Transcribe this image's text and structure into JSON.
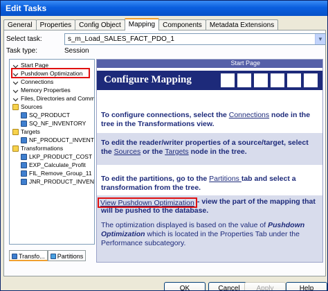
{
  "window": {
    "title": "Edit Tasks"
  },
  "tabs": [
    {
      "label": "General"
    },
    {
      "label": "Properties"
    },
    {
      "label": "Config Object"
    },
    {
      "label": "Mapping",
      "active": true
    },
    {
      "label": "Components"
    },
    {
      "label": "Metadata Extensions"
    }
  ],
  "form": {
    "select_task_label": "Select task:",
    "select_task_value": "s_m_Load_SALES_FACT_PDO_1",
    "task_type_label": "Task type:",
    "task_type_value": "Session"
  },
  "tree": {
    "items": [
      {
        "label": "Start Page",
        "icon": "node-icon",
        "indent": 0
      },
      {
        "label": "Pushdown Optimization",
        "icon": "node-icon",
        "indent": 0,
        "highlighted": true
      },
      {
        "label": "Connections",
        "icon": "node-icon",
        "indent": 0
      },
      {
        "label": "Memory Properties",
        "icon": "node-icon",
        "indent": 0
      },
      {
        "label": "Files, Directories and Commar",
        "icon": "node-icon",
        "indent": 0
      },
      {
        "label": "Sources",
        "icon": "folder-icon",
        "indent": 0
      },
      {
        "label": "SQ_PRODUCT",
        "icon": "object-icon",
        "indent": 1
      },
      {
        "label": "SQ_NF_INVENTORY",
        "icon": "object-icon",
        "indent": 1
      },
      {
        "label": "Targets",
        "icon": "folder-icon",
        "indent": 0
      },
      {
        "label": "NF_PRODUCT_INVENTOR",
        "icon": "object-icon",
        "indent": 1
      },
      {
        "label": "Transformations",
        "icon": "folder-icon",
        "indent": 0
      },
      {
        "label": "LKP_PRODUCT_COST",
        "icon": "object-icon",
        "indent": 1
      },
      {
        "label": "EXP_Calculate_Profit",
        "icon": "object-icon",
        "indent": 1
      },
      {
        "label": "FIL_Remove_Group_11",
        "icon": "object-icon",
        "indent": 1
      },
      {
        "label": "JNR_PRODUCT_INVENTO",
        "icon": "object-icon",
        "indent": 1
      }
    ]
  },
  "bottom_tabs": [
    {
      "label": "Transfo...",
      "active": true
    },
    {
      "label": "Partitions"
    }
  ],
  "content": {
    "header": "Start Page",
    "banner_title": "Configure Mapping",
    "p1_pre": "To configure connections, select the ",
    "p1_link": "Connections",
    "p1_post": " node in the tree in the Transformations view.",
    "p2_pre": "To edit the reader/writer properties of a source/target, select the ",
    "p2_link1": "Sources",
    "p2_mid": " or the ",
    "p2_link2": "Targets",
    "p2_post": " node in the tree.",
    "p3_pre": "To edit the partitions, go to the ",
    "p3_link": "Partitions ",
    "p3_post": "tab and select a transformation from the tree.",
    "p4_link": "View Pushdown Optimization",
    "p4_post": " - view the part of the mapping that will be pushed to the database.",
    "p5_pre": "The optimization displayed is based on the value of ",
    "p5_it": "Pushdown Optimization",
    "p5_post": " which is located in the Properties Tab under the Performance subcategory."
  },
  "buttons": {
    "ok": "OK",
    "cancel": "Cancel",
    "apply": "Apply",
    "help": "Help"
  },
  "colors": {
    "title_bar": "#0a5fdf",
    "banner": "#1d2a7a",
    "highlight": "#e01010"
  }
}
